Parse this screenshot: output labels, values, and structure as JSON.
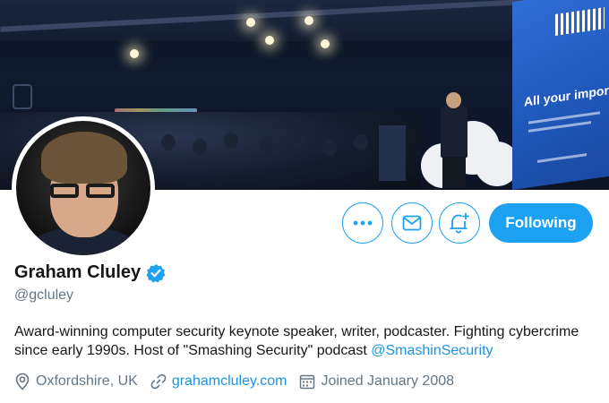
{
  "banner": {
    "screen_text": "All your important files"
  },
  "actions": {
    "more_icon": "more-dots-icon",
    "message_icon": "envelope-icon",
    "notify_icon": "bell-plus-icon",
    "follow_label": "Following"
  },
  "profile": {
    "name": "Graham Cluley",
    "verified": true,
    "handle": "@gcluley",
    "bio_text": "Award-winning computer security keynote speaker, writer, podcaster. Fighting cybercrime since early 1990s. Host of \"Smashing Security\" podcast ",
    "bio_mention": "@SmashinSecurity",
    "location": "Oxfordshire, UK",
    "website": "grahamcluley.com",
    "joined": "Joined January 2008"
  },
  "colors": {
    "accent": "#1da1f2",
    "link": "#1b95e0",
    "secondary_text": "#657786"
  }
}
